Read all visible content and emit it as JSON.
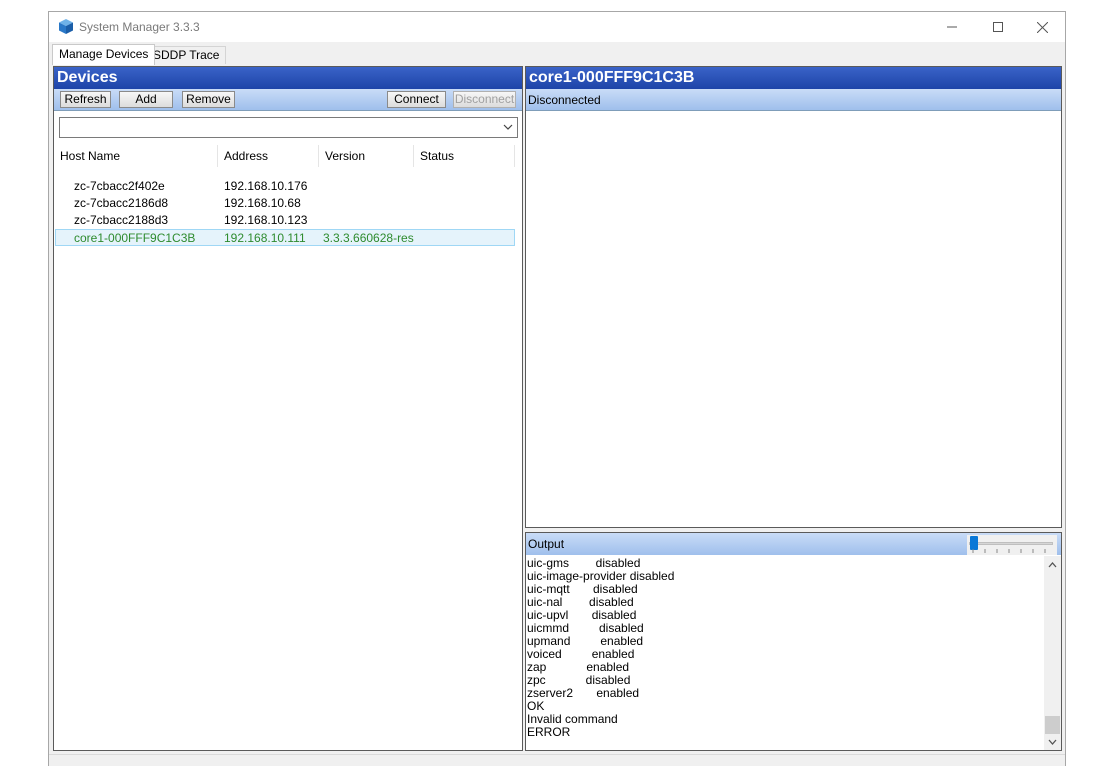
{
  "window": {
    "title": "System Manager 3.3.3"
  },
  "tabs": [
    {
      "label": "Manage Devices",
      "active": true
    },
    {
      "label": "SDDP Trace",
      "active": false
    }
  ],
  "devices": {
    "title": "Devices",
    "toolbar": {
      "refresh": "Refresh",
      "add": "Add",
      "remove": "Remove",
      "connect": "Connect",
      "disconnect": "Disconnect"
    },
    "filter_value": "",
    "columns": [
      "Host Name",
      "Address",
      "Version",
      "Status"
    ],
    "rows": [
      {
        "host": "zc-7cbacc2f402e",
        "address": "192.168.10.176",
        "version": "",
        "status": "",
        "selected": false
      },
      {
        "host": "zc-7cbacc2186d8",
        "address": "192.168.10.68",
        "version": "",
        "status": "",
        "selected": false
      },
      {
        "host": "zc-7cbacc2188d3",
        "address": "192.168.10.123",
        "version": "",
        "status": "",
        "selected": false
      },
      {
        "host": "core1-000FFF9C1C3B",
        "address": "192.168.10.111",
        "version": "3.3.3.660628-res",
        "status": "",
        "selected": true
      }
    ]
  },
  "detail": {
    "title": "core1-000FFF9C1C3B",
    "status": "Disconnected"
  },
  "output": {
    "label": "Output",
    "lines": [
      "uic-gms        disabled",
      "uic-image-provider disabled",
      "uic-mqtt       disabled",
      "uic-nal        disabled",
      "uic-upvl       disabled",
      "uicmmd         disabled",
      "upmand         enabled",
      "voiced         enabled",
      "zap            enabled",
      "zpc            disabled",
      "zserver2       enabled",
      "OK",
      "Invalid command",
      "ERROR"
    ]
  },
  "colors": {
    "header_blue": "#1d44a8",
    "toolbar_blue": "#b7cff2",
    "selected_text": "#2e8b2e",
    "slider_thumb": "#0a78d7"
  }
}
